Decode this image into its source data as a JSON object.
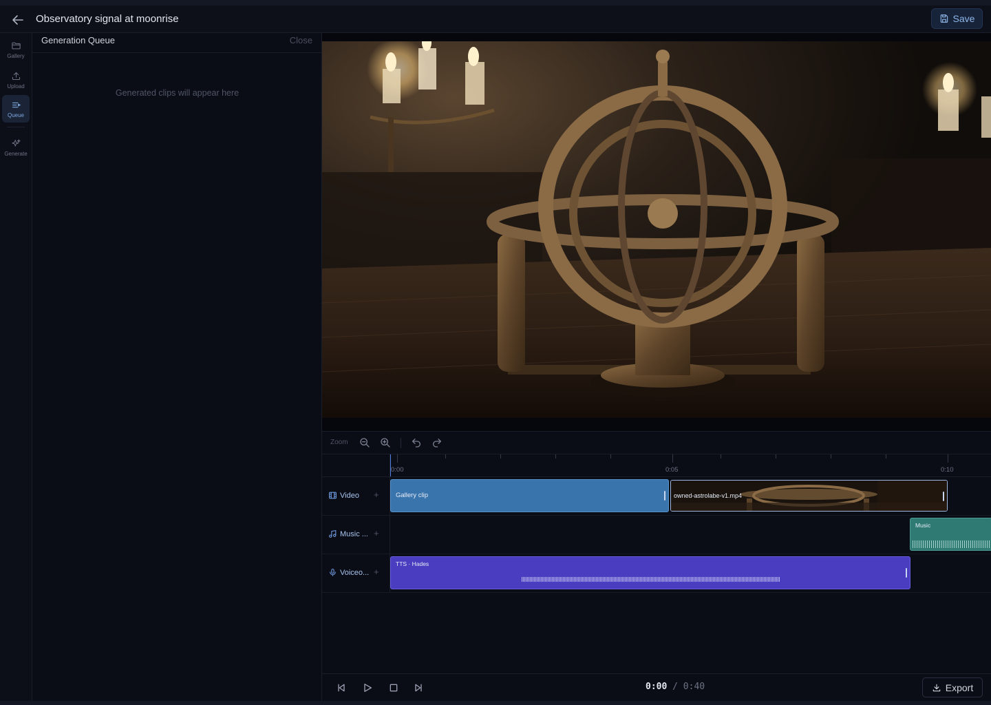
{
  "header": {
    "title": "Observatory signal at moonrise",
    "save_label": "Save",
    "back_icon": "arrow-left-icon"
  },
  "rail": {
    "items": [
      {
        "label": "Gallery",
        "icon": "folder-icon",
        "active": false
      },
      {
        "label": "Upload",
        "icon": "upload-icon",
        "active": false
      },
      {
        "label": "Queue",
        "icon": "list-icon",
        "active": true
      },
      {
        "label": "Generate",
        "icon": "sparkle-icon",
        "active": false
      }
    ]
  },
  "queue_panel": {
    "title": "Generation Queue",
    "close_label": "Close",
    "empty_message": "Generated clips will appear here"
  },
  "timeline": {
    "zoom_label": "Zoom",
    "ruler_labels": [
      "0:00",
      "0:05",
      "0:10"
    ],
    "tracks": [
      {
        "label": "Video",
        "icon": "film-icon"
      },
      {
        "label": "Music ...",
        "icon": "music-icon"
      },
      {
        "label": "Voiceo...",
        "icon": "mic-icon"
      }
    ],
    "clips": {
      "gallery_clip": "Gallery clip",
      "astrolabe_clip": "owned-astrolabe-v1.mp4",
      "music_clip": "Music",
      "tts_clip": "TTS · Hades"
    }
  },
  "transport": {
    "current_time": "0:00",
    "separator": "/",
    "total_time": "0:40",
    "export_label": "Export"
  },
  "colors": {
    "video_clip": "#3a74ac",
    "tts_clip": "#4a3dbf",
    "music_clip": "#2f7a73",
    "accent": "#7fa7dc"
  }
}
